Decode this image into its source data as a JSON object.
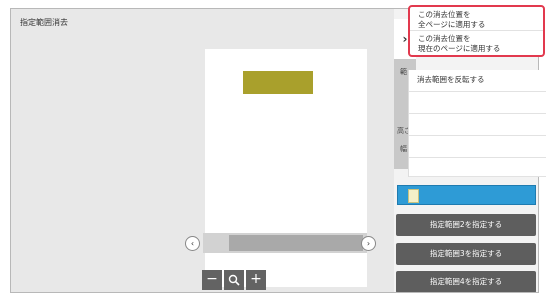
{
  "title": "指定範囲消去",
  "panel": {
    "tab_chevron": "›",
    "strip_labels": [
      "範",
      "高さ",
      "幅"
    ]
  },
  "menu": {
    "apply_all": [
      "この消去位置を",
      "全ページに適用する"
    ],
    "apply_current": [
      "この消去位置を",
      "現在のページに適用する"
    ],
    "invert": "消去範囲を反転する"
  },
  "range_buttons": [
    "指定範囲2を指定する",
    "指定範囲3を指定する",
    "指定範囲4を指定する"
  ],
  "zoom": {
    "out": "−",
    "fit": "🔍",
    "in": "+"
  },
  "scroll": {
    "left": "‹",
    "right": "›"
  },
  "colors": {
    "erase_area": "#a9a02c",
    "highlight": "#e2394e",
    "selected_tile": "#2e9bd6"
  }
}
